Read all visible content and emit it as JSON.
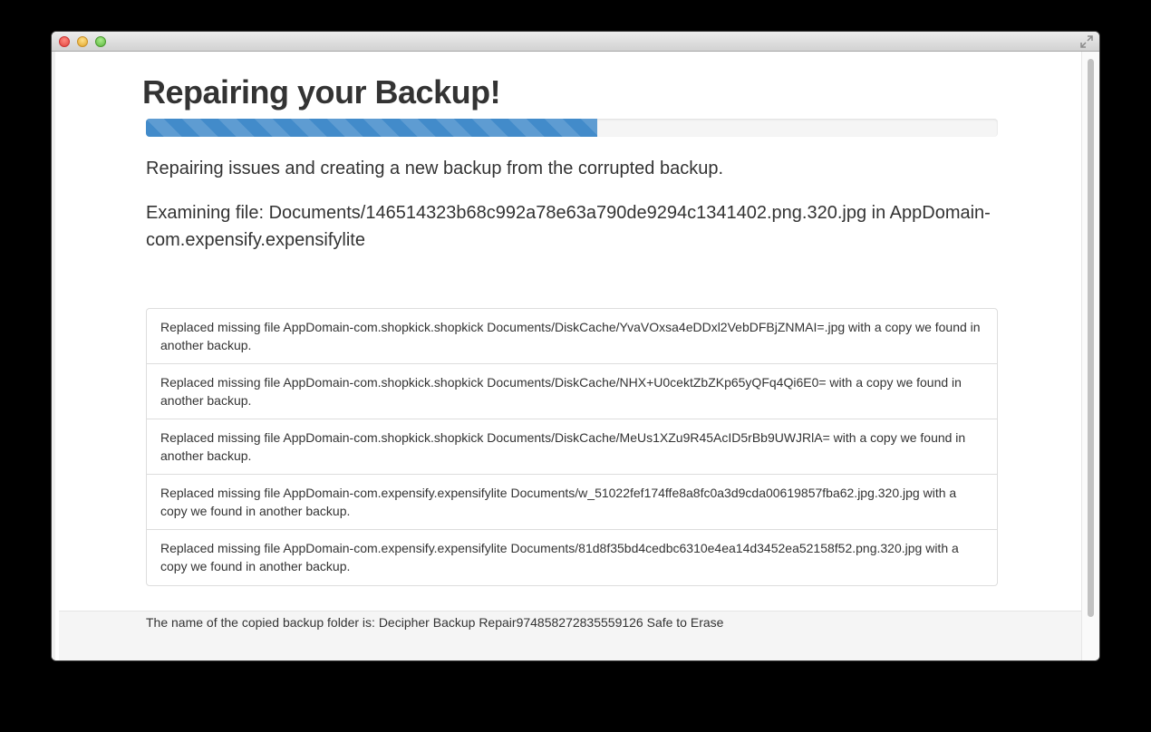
{
  "window": {
    "title": "",
    "progress_fraction": 0.53,
    "accent_color": "#428bca"
  },
  "main": {
    "heading": "Repairing your Backup!",
    "status": "Repairing issues and creating a new backup from the corrupted backup.",
    "examining": "Examining file: Documents/146514323b68c992a78e63a790de9294c1341402.png.320.jpg in AppDomain-com.expensify.expensifylite"
  },
  "log": {
    "items": [
      "Replaced missing file AppDomain-com.shopkick.shopkick Documents/DiskCache/YvaVOxsa4eDDxl2VebDFBjZNMAI=.jpg with a copy we found in another backup.",
      "Replaced missing file AppDomain-com.shopkick.shopkick Documents/DiskCache/NHX+U0cektZbZKp65yQFq4Qi6E0= with a copy we found in another backup.",
      "Replaced missing file AppDomain-com.shopkick.shopkick Documents/DiskCache/MeUs1XZu9R45AcID5rBb9UWJRlA= with a copy we found in another backup.",
      "Replaced missing file AppDomain-com.expensify.expensifylite Documents/w_51022fef174ffe8a8fc0a3d9cda00619857fba62.jpg.320.jpg with a copy we found in another backup.",
      "Replaced missing file AppDomain-com.expensify.expensifylite Documents/81d8f35bd4cedbc6310e4ea14d3452ea52158f52.png.320.jpg with a copy we found in another backup."
    ]
  },
  "footer": {
    "text": "The name of the copied backup folder is: Decipher Backup Repair974858272835559126 Safe to Erase"
  },
  "icons": {
    "close": "close-button-icon",
    "minimize": "minimize-button-icon",
    "zoom": "zoom-button-icon",
    "fullscreen": "fullscreen-arrows-icon"
  }
}
